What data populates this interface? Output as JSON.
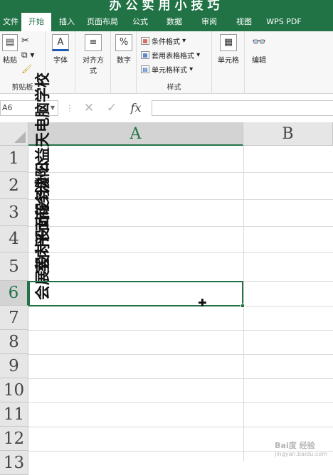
{
  "window": {
    "title": "办公实用小技巧"
  },
  "tabs": [
    {
      "label": "文件",
      "active": false
    },
    {
      "label": "开始",
      "active": true
    },
    {
      "label": "插入",
      "active": false
    },
    {
      "label": "页面布局",
      "active": false
    },
    {
      "label": "公式",
      "active": false
    },
    {
      "label": "数据",
      "active": false
    },
    {
      "label": "审阅",
      "active": false
    },
    {
      "label": "视图",
      "active": false
    },
    {
      "label": "WPS PDF",
      "active": false
    }
  ],
  "ribbon": {
    "clipboard": {
      "paste_label": "粘贴",
      "group_label": "剪贴板"
    },
    "font": {
      "label": "字体"
    },
    "alignment": {
      "label": "对齐方式"
    },
    "number": {
      "label": "数字"
    },
    "styles": {
      "conditional_format": "条件格式",
      "table_format": "套用表格格式",
      "cell_styles": "单元格样式",
      "group_label": "样式"
    },
    "cells": {
      "label": "单元格"
    },
    "editing": {
      "label": "编辑"
    }
  },
  "formula_bar": {
    "name_box": "A6",
    "fx": "fx",
    "value": ""
  },
  "grid": {
    "columns": [
      "A",
      "B"
    ],
    "selected_column": "A",
    "rows": [
      "1",
      "2",
      "3",
      "4",
      "5",
      "6",
      "7",
      "8",
      "9",
      "10",
      "11",
      "12",
      "13"
    ],
    "selected_row": "6",
    "cells": [
      {
        "ref": "A1",
        "value": "濮阳益天电脑学校"
      },
      {
        "ref": "A2",
        "value": "商务办公"
      },
      {
        "ref": "A3",
        "value": "平面设计"
      },
      {
        "ref": "A4",
        "value": "室内设计"
      },
      {
        "ref": "A5",
        "value": "会展设计"
      }
    ]
  },
  "watermark": {
    "text": "Bai度 经验",
    "sub": "jingyan.baidu.com"
  }
}
